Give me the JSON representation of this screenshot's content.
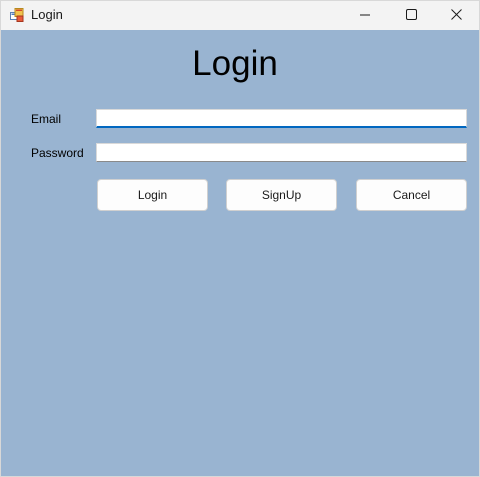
{
  "window": {
    "title": "Login",
    "icon": "winforms-app-icon",
    "controls": {
      "minimize_icon": "minimize-icon",
      "maximize_icon": "maximize-icon",
      "close_icon": "close-icon"
    }
  },
  "form": {
    "heading": "Login",
    "email_label": "Email",
    "email_value": "",
    "password_label": "Password",
    "password_value": "",
    "buttons": {
      "login": "Login",
      "signup": "SignUp",
      "cancel": "Cancel"
    }
  },
  "colors": {
    "form_background": "#99b4d1",
    "titlebar_background": "#f3f3f3",
    "focus_accent": "#0067c0"
  }
}
